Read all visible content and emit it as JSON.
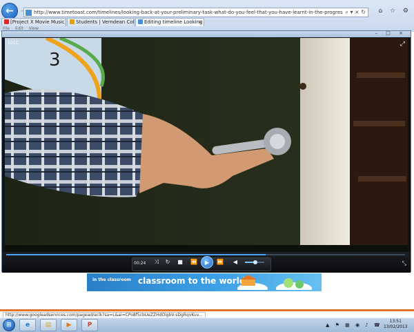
{
  "browser": {
    "url": "http://www.timetoast.com/timelines/looking-back-at-your-preliminary-task-what-do-you-feel-that-you-have-learnt-in-the-progression-from-it-to-the-full-product/edit",
    "address_icons": "⌕ ▾ × ↻",
    "tabs": [
      {
        "label": "[Project X Movie Music] Heads...",
        "icon_color": "#d92b2b"
      },
      {
        "label": "Students | Verndean College, B...",
        "icon_color": "#e5a100"
      },
      {
        "label": "Editing timeline Looking ba...",
        "icon_color": "#4a8ed4"
      }
    ],
    "window_controls": "⌂ ☆ ⚙",
    "status_url": "http://www.googleadservices.com/pagead/aclk?sa=L&ai=CPo8f5cbUeZZHdOigbV-sDgRqvKuv..."
  },
  "ad": {
    "small_text": "in the classroom",
    "headline": "classroom to the world"
  },
  "player": {
    "window_controls": "– □ ×",
    "video_label": "101C",
    "fullscreen_glyph": "⤢",
    "time": "00:24",
    "progress": 0.65,
    "volume": 0.55,
    "buttons": {
      "shuffle": "⤨",
      "repeat": "↻",
      "stop": "■",
      "previous": "⏪",
      "play": "▶",
      "next": "⏩",
      "mute": "◀"
    },
    "exit_fullscreen_glyph": "⤡"
  },
  "taskbar": {
    "start_glyph": "⊞",
    "apps": [
      {
        "name": "internet-explorer",
        "glyph": "e",
        "color": "#1a73d4"
      },
      {
        "name": "windows-explorer",
        "glyph": "▤",
        "color": "#d9a21e"
      },
      {
        "name": "media-player",
        "glyph": "▶",
        "color": "#e07a12"
      },
      {
        "name": "powerpoint",
        "glyph": "P",
        "color": "#c8452a"
      }
    ],
    "tray_icons": "▲ ⚑ ▦ ◉ ♪ ☎",
    "time": "13:51",
    "date": "13/02/2013"
  }
}
